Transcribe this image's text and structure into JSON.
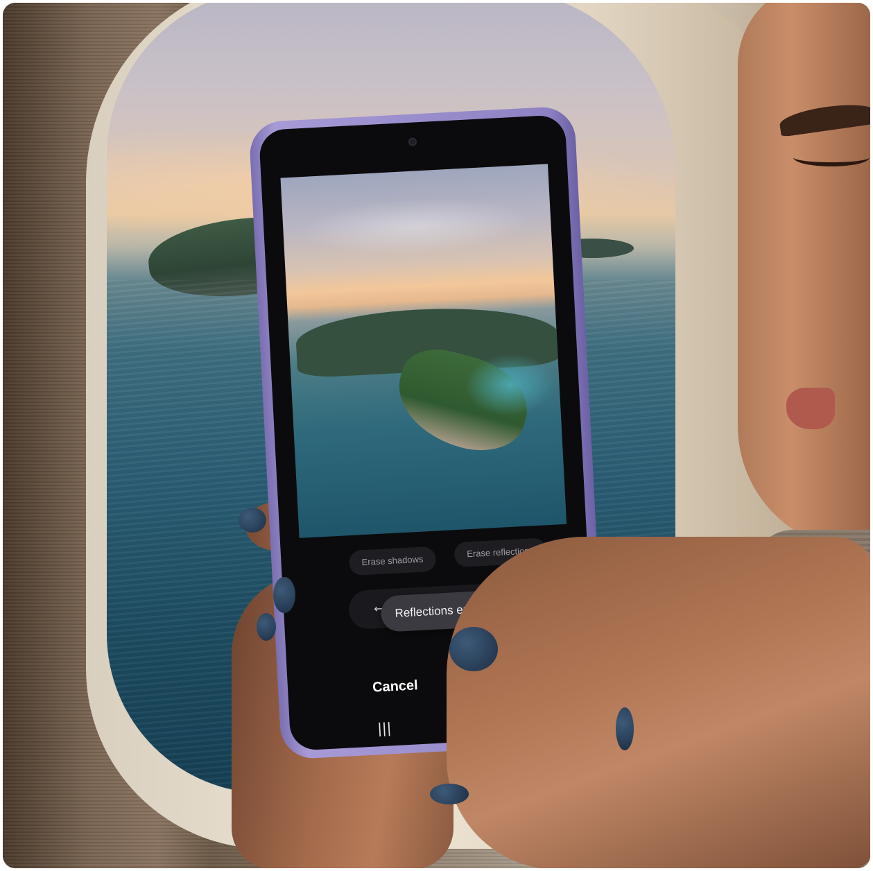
{
  "phone": {
    "chips": {
      "erase_shadows": "Erase shadows",
      "erase_reflections": "Erase reflections"
    },
    "undo_icon": "undo-arrow-icon",
    "toast": "Reflections erased.",
    "cancel_label": "Cancel",
    "nav": {
      "recents_icon": "recents-icon",
      "home_icon": "home-icon",
      "back_icon": "back-icon"
    },
    "colors": {
      "frame": "#8e82c4",
      "screen": "#0b0b0d",
      "toast_bg": "#3a3a40",
      "chip_bg": "#1e1e22"
    }
  }
}
